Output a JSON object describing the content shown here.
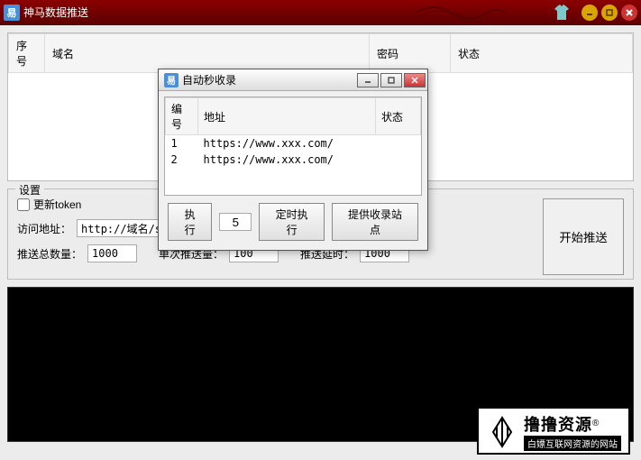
{
  "window": {
    "title": "神马数据推送",
    "icon_glyph": "易"
  },
  "main_table": {
    "columns": [
      "序号",
      "域名",
      "密码",
      "状态"
    ]
  },
  "settings": {
    "legend": "设置",
    "update_token_label": "更新token",
    "update_token_checked": false,
    "visit_url_label": "访问地址：",
    "visit_url_value": "http://域名/sitemap.xml",
    "push_total_label": "推送总数量：",
    "push_total_value": "1000",
    "push_batch_label": "单次推送量：",
    "push_batch_value": "100",
    "push_delay_label": "推送延时：",
    "push_delay_value": "1000",
    "start_button": "开始推送"
  },
  "modal": {
    "title": "自动秒收录",
    "columns": [
      "编号",
      "地址",
      "状态"
    ],
    "rows": [
      {
        "id": "1",
        "url": "https://www.xxx.com/",
        "status": ""
      },
      {
        "id": "2",
        "url": "https://www.xxx.com/",
        "status": ""
      }
    ],
    "execute_btn": "执行",
    "interval_value": "5",
    "timed_btn": "定时执行",
    "provide_btn": "提供收录站点"
  },
  "watermark": {
    "main": "撸撸资源",
    "sup": "®",
    "sub": "白嫖互联网资源的网站"
  }
}
